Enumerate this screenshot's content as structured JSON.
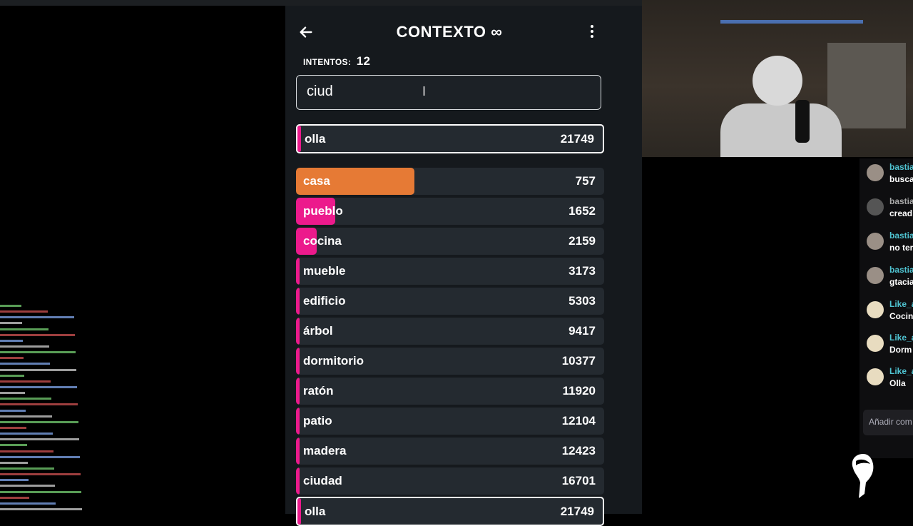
{
  "game": {
    "title": "CONTEXTO",
    "title_symbol": "∞",
    "attempts_label": "INTENTOS:",
    "attempts_value": "12",
    "input_value": "ciud",
    "current_guess": {
      "word": "olla",
      "rank": "21749"
    },
    "guesses": [
      {
        "word": "casa",
        "rank": "757",
        "color": "#e67a35",
        "fill": 0.385
      },
      {
        "word": "pueblo",
        "rank": "1652",
        "color": "#ec1a8c",
        "fill": 0.128
      },
      {
        "word": "cocina",
        "rank": "2159",
        "color": "#ec1a8c",
        "fill": 0.068
      },
      {
        "word": "mueble",
        "rank": "3173",
        "color": "#ec1a8c",
        "fill": 0.012
      },
      {
        "word": "edificio",
        "rank": "5303",
        "color": "#ec1a8c",
        "fill": 0.012
      },
      {
        "word": "árbol",
        "rank": "9417",
        "color": "#ec1a8c",
        "fill": 0.012
      },
      {
        "word": "dormitorio",
        "rank": "10377",
        "color": "#ec1a8c",
        "fill": 0.012
      },
      {
        "word": "ratón",
        "rank": "11920",
        "color": "#ec1a8c",
        "fill": 0.012
      },
      {
        "word": "patio",
        "rank": "12104",
        "color": "#ec1a8c",
        "fill": 0.012
      },
      {
        "word": "madera",
        "rank": "12423",
        "color": "#ec1a8c",
        "fill": 0.012
      },
      {
        "word": "ciudad",
        "rank": "16701",
        "color": "#ec1a8c",
        "fill": 0.012
      },
      {
        "word": "olla",
        "rank": "21749",
        "color": "#ec1a8c",
        "fill": 0.012
      }
    ]
  },
  "chat": {
    "messages": [
      {
        "user": "bastia",
        "text": "busca",
        "avatar": "#9a8f86"
      },
      {
        "user": "bastia",
        "text": "cread",
        "avatar": "#555",
        "system": true
      },
      {
        "user": "bastia",
        "text": "no ter",
        "avatar": "#9a8f86"
      },
      {
        "user": "bastia",
        "text": "gtacia",
        "avatar": "#9a8f86"
      },
      {
        "user": "Like_a",
        "text": "Cocin",
        "avatar": "#e8dcc0"
      },
      {
        "user": "Like_a",
        "text": "Dorm",
        "avatar": "#e8dcc0"
      },
      {
        "user": "Like_a",
        "text": "Olla",
        "avatar": "#e8dcc0"
      }
    ],
    "input_placeholder": "Añadir com"
  }
}
